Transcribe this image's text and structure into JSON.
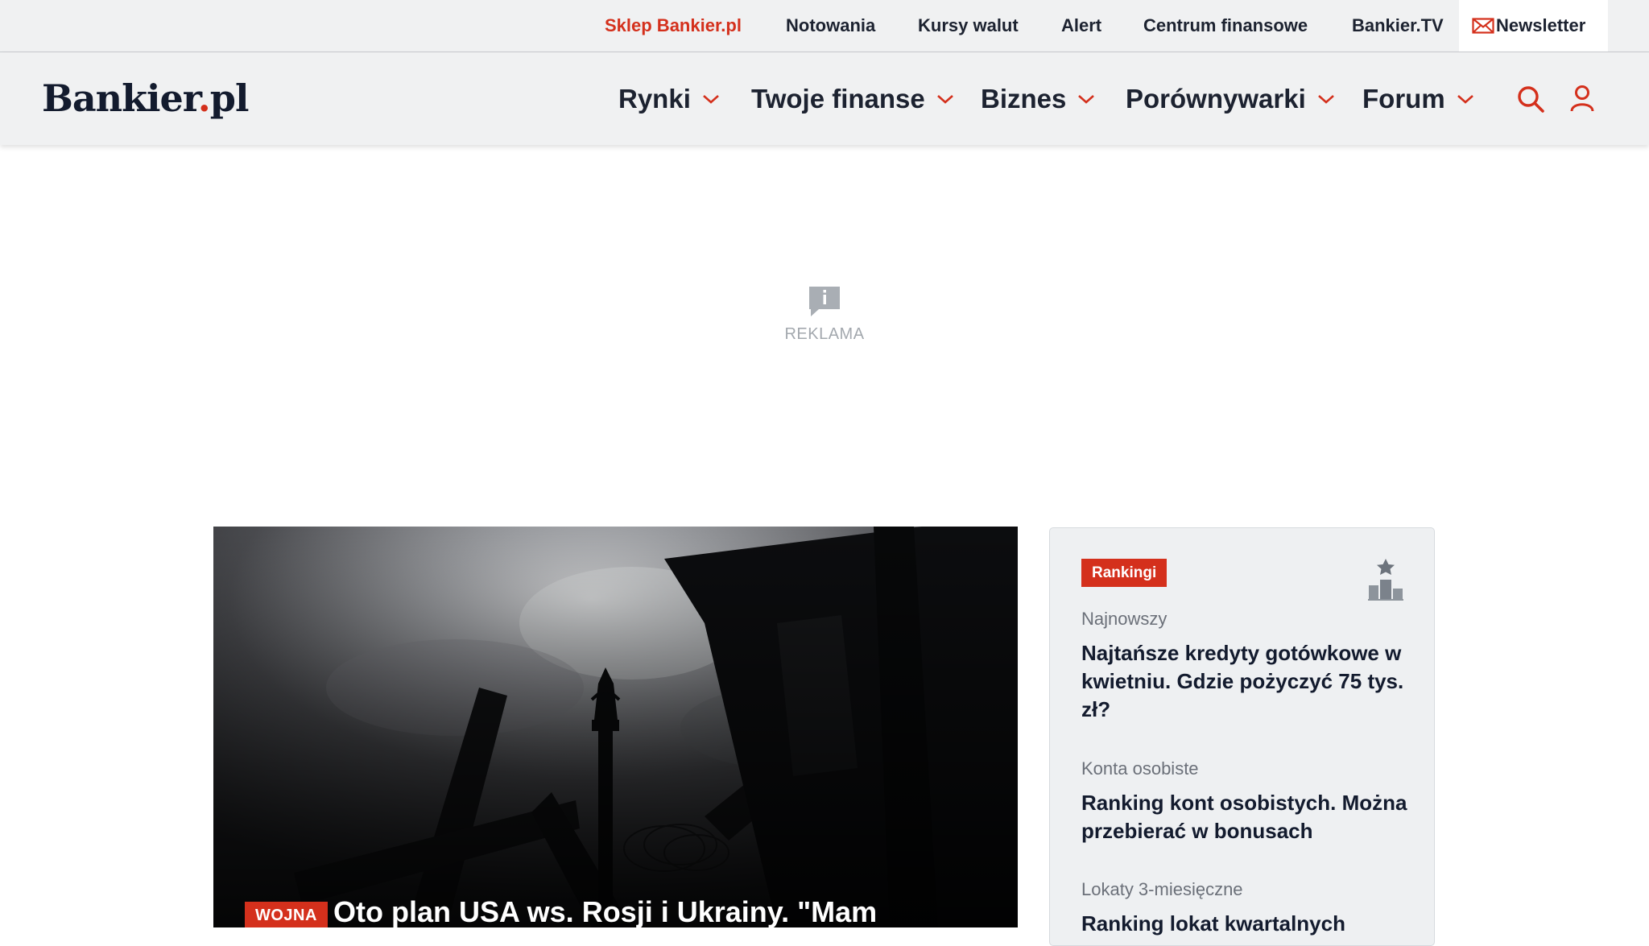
{
  "topbar": {
    "links": [
      {
        "label": "Sklep Bankier.pl"
      },
      {
        "label": "Notowania"
      },
      {
        "label": "Kursy walut"
      },
      {
        "label": "Alert"
      },
      {
        "label": "Centrum finansowe"
      },
      {
        "label": "Bankier.TV"
      }
    ],
    "newsletter_label": "Newsletter"
  },
  "header": {
    "logo_main": "Bankier",
    "logo_dot": ".",
    "logo_tld": "pl",
    "nav": [
      {
        "label": "Rynki"
      },
      {
        "label": "Twoje finanse"
      },
      {
        "label": "Biznes"
      },
      {
        "label": "Porównywarki"
      },
      {
        "label": "Forum"
      }
    ],
    "icons": {
      "search": "search-icon",
      "account": "user-icon"
    }
  },
  "ad": {
    "label": "REKLAMA",
    "icon": "info-icon"
  },
  "hero": {
    "tag": "WOJNA",
    "title": "Oto plan USA ws. Rosji i Ukrainy. \"Mam"
  },
  "sidebar": {
    "badge": "Rankingi",
    "icon": "podium-icon",
    "items": [
      {
        "category": "Najnowszy",
        "title": "Najtańsze kredyty gotówkowe w kwietniu. Gdzie pożyczyć 75 tys. zł?"
      },
      {
        "category": "Konta osobiste",
        "title": "Ranking kont osobistych. Można przebierać w bonusach"
      },
      {
        "category": "Lokaty 3-miesięczne",
        "title": "Ranking lokat kwartalnych"
      }
    ]
  },
  "colors": {
    "accent": "#d4301c",
    "text_dark": "#1c2230",
    "header_bg": "#f0f1f2",
    "sidebar_bg": "#eef0f2"
  }
}
